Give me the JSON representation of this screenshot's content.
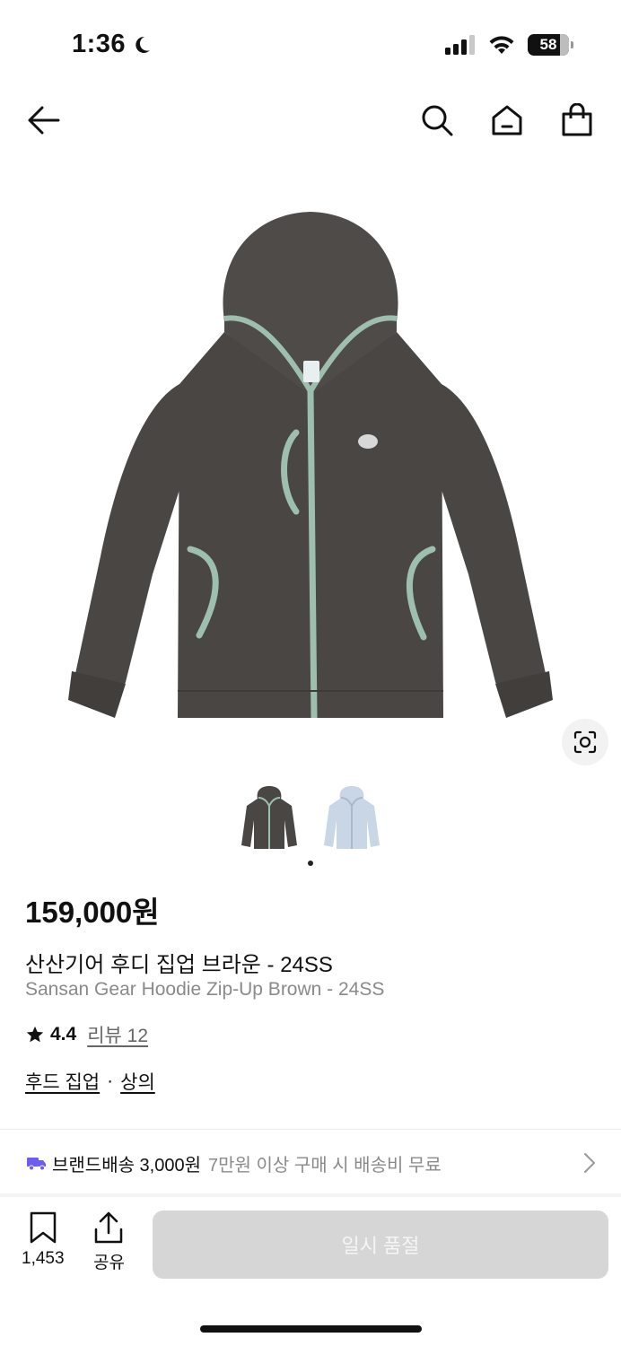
{
  "status_bar": {
    "time": "1:36",
    "battery": "58"
  },
  "product": {
    "price": "159,000원",
    "name_ko": "산산기어 후디 집업 브라운 - 24SS",
    "name_en": "Sansan Gear Hoodie Zip-Up Brown - 24SS",
    "rating": "4.4",
    "review_label": "리뷰 12",
    "categories": [
      "후드 집업",
      "상의"
    ],
    "category_separator": "·",
    "selected_thumbnail_index": 0,
    "colors": {
      "body": "#4a4643",
      "trim": "#9dbfae",
      "alt_body": "#c9d6e6"
    }
  },
  "shipping": {
    "strong": "브랜드배송 3,000원",
    "sub": "7만원 이상 구매 시 배송비 무료"
  },
  "bottom_bar": {
    "bookmark_count": "1,453",
    "share_label": "공유",
    "cta_label": "일시 품절"
  },
  "theme": {
    "accent": "#6b5cf6",
    "disabled_button": "#d6d6d6"
  }
}
